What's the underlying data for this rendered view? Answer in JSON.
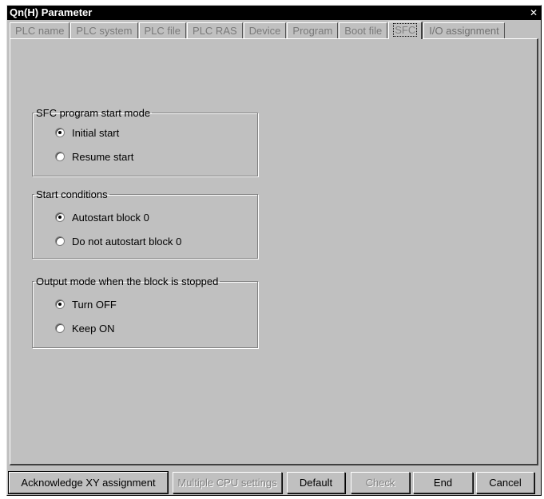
{
  "window": {
    "title": "Qn(H) Parameter",
    "close_glyph": "✕"
  },
  "tabs": [
    {
      "label": "PLC name"
    },
    {
      "label": "PLC system"
    },
    {
      "label": "PLC file"
    },
    {
      "label": "PLC RAS"
    },
    {
      "label": "Device"
    },
    {
      "label": "Program"
    },
    {
      "label": "Boot file"
    },
    {
      "label": "SFC",
      "active": true
    },
    {
      "label": "I/O assignment"
    }
  ],
  "groups": {
    "start_mode": {
      "title": "SFC program start mode",
      "options": [
        "Initial start",
        "Resume start"
      ],
      "selected": "Initial start"
    },
    "start_conditions": {
      "title": "Start conditions",
      "options": [
        "Autostart block 0",
        "Do not autostart block 0"
      ],
      "selected": "Autostart block 0"
    },
    "output_mode": {
      "title": "Output mode when the block is stopped",
      "options": [
        "Turn OFF",
        "Keep ON"
      ],
      "selected": "Turn OFF"
    }
  },
  "buttons": {
    "acknowledge": "Acknowledge XY assignment",
    "multiple_cpu": "Multiple CPU settings",
    "default": "Default",
    "check": "Check",
    "end": "End",
    "cancel": "Cancel"
  }
}
